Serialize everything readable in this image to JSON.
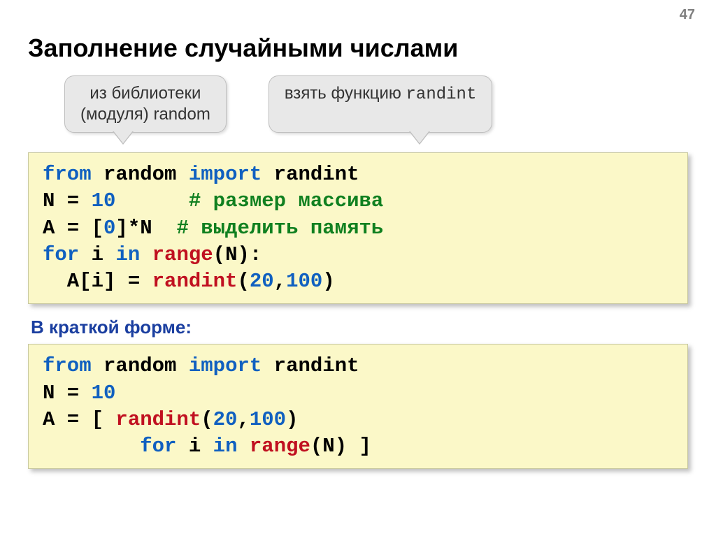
{
  "page_number": "47",
  "title": "Заполнение случайными числами",
  "callouts": {
    "c1_line1": "из библиотеки",
    "c1_line2": "(модуля) random",
    "c2_prefix": "взять функцию ",
    "c2_mono": "randint"
  },
  "code1": {
    "l1_kw1": "from",
    "l1_t1": " random ",
    "l1_kw2": "import",
    "l1_t2": " randint",
    "l2_a": "N = ",
    "l2_num": "10",
    "l2_sp": "      ",
    "l2_cm": "# размер массива",
    "l3_a": "A = [",
    "l3_num": "0",
    "l3_b": "]*N  ",
    "l3_cm": "# выделить память",
    "l4_kw1": "for",
    "l4_a": " i ",
    "l4_kw2": "in",
    "l4_b": " ",
    "l4_fn": "range",
    "l4_c": "(N):",
    "l5_a": "  A[i] = ",
    "l5_fn": "randint",
    "l5_b": "(",
    "l5_n1": "20",
    "l5_c": ",",
    "l5_n2": "100",
    "l5_d": ")"
  },
  "subhead": "В краткой форме:",
  "code2": {
    "l1_kw1": "from",
    "l1_t1": " random ",
    "l1_kw2": "import",
    "l1_t2": " randint",
    "l2_a": "N = ",
    "l2_num": "10",
    "l3_a": "A = [ ",
    "l3_fn": "randint",
    "l3_b": "(",
    "l3_n1": "20",
    "l3_c": ",",
    "l3_n2": "100",
    "l3_d": ")",
    "l4_a": "        ",
    "l4_kw1": "for",
    "l4_b": " i ",
    "l4_kw2": "in",
    "l4_c": " ",
    "l4_fn": "range",
    "l4_d": "(N) ]"
  }
}
